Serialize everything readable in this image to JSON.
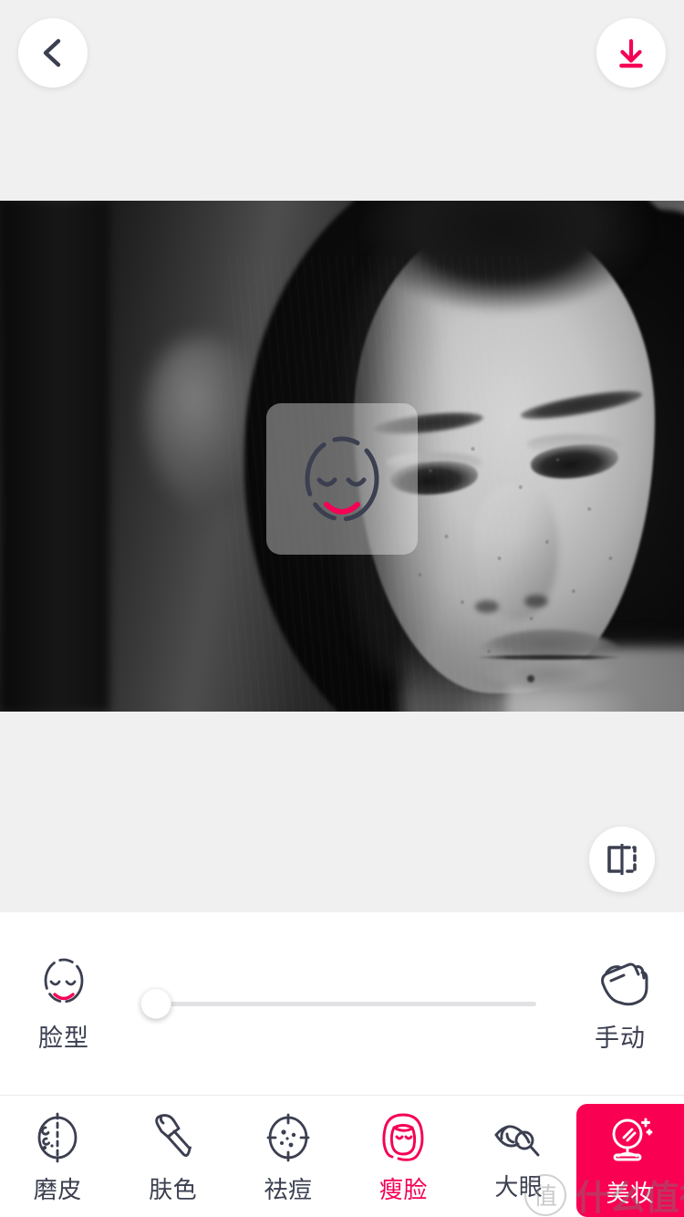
{
  "app": {
    "accent_pink": "#f50055",
    "dark_navy": "#3b3f50",
    "page_bg": "#f0f0f0",
    "panel_bg": "#ffffff"
  },
  "topbar": {
    "back_icon": "chevron-left-icon",
    "save_icon": "download-icon",
    "back_label": "",
    "save_label": ""
  },
  "photo": {
    "description": "Black and white portrait of a young woman with freckles and long dark hair looking downward",
    "overlay_toast": {
      "icon": "face-shape-icon",
      "label": ""
    }
  },
  "compare": {
    "icon": "before-after-compare-icon",
    "label": ""
  },
  "slider_panel": {
    "mode": {
      "icon": "face-shape-icon",
      "label": "脸型"
    },
    "slider": {
      "value": 0,
      "min": 0,
      "max": 100
    },
    "manual": {
      "icon": "tap-hand-icon",
      "label": "手动"
    }
  },
  "toolbar": {
    "items": [
      {
        "label": "磨皮",
        "icon": "smooth-skin-icon",
        "active": false
      },
      {
        "label": "肤色",
        "icon": "makeup-brush-icon",
        "active": false
      },
      {
        "label": "祛痘",
        "icon": "acne-target-icon",
        "active": false
      },
      {
        "label": "瘦脸",
        "icon": "slim-face-icon",
        "active": true
      },
      {
        "label": "大眼",
        "icon": "eye-magnify-icon",
        "active": false
      }
    ],
    "promo": {
      "label": "美妆",
      "icon": "vanity-mirror-icon",
      "bg": "#f90052"
    }
  },
  "watermark": {
    "logo_char": "值",
    "text": "什么值得买"
  }
}
